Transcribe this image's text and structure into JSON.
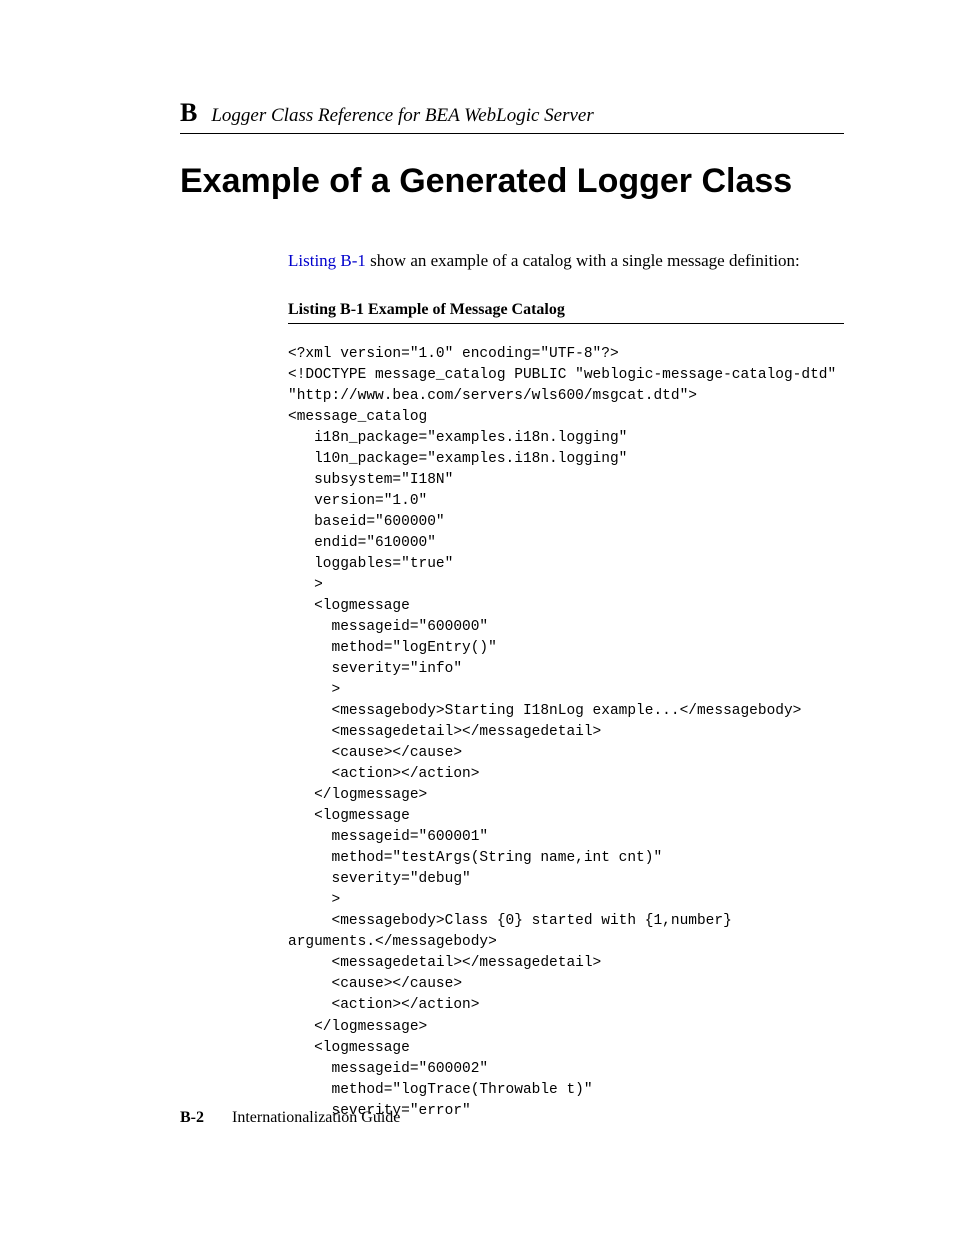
{
  "header": {
    "appendix_letter": "B",
    "running_title": "Logger Class Reference for BEA WebLogic Server"
  },
  "heading": "Example of a Generated Logger Class",
  "intro": {
    "link_text": "Listing B-1",
    "rest": " show an example of a catalog with a single message definition:"
  },
  "listing": {
    "label": "Listing B-1   Example of Message Catalog",
    "code": "<?xml version=\"1.0\" encoding=\"UTF-8\"?>\n<!DOCTYPE message_catalog PUBLIC \"weblogic-message-catalog-dtd\"\n\"http://www.bea.com/servers/wls600/msgcat.dtd\">\n<message_catalog\n   i18n_package=\"examples.i18n.logging\"\n   l10n_package=\"examples.i18n.logging\"\n   subsystem=\"I18N\"\n   version=\"1.0\"\n   baseid=\"600000\"\n   endid=\"610000\"\n   loggables=\"true\"\n   >\n   <logmessage\n     messageid=\"600000\"\n     method=\"logEntry()\"\n     severity=\"info\"\n     >\n     <messagebody>Starting I18nLog example...</messagebody>\n     <messagedetail></messagedetail>\n     <cause></cause>\n     <action></action>\n   </logmessage>\n   <logmessage\n     messageid=\"600001\"\n     method=\"testArgs(String name,int cnt)\"\n     severity=\"debug\"\n     >\n     <messagebody>Class {0} started with {1,number}\narguments.</messagebody>\n     <messagedetail></messagedetail>\n     <cause></cause>\n     <action></action>\n   </logmessage>\n   <logmessage\n     messageid=\"600002\"\n     method=\"logTrace(Throwable t)\"\n     severity=\"error\""
  },
  "footer": {
    "page_number": "B-2",
    "doc_title": "Internationalization Guide"
  }
}
